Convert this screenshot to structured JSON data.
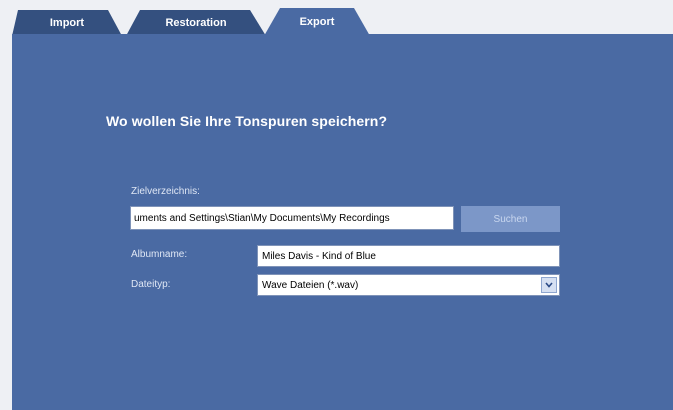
{
  "tabs": [
    {
      "label": "Import"
    },
    {
      "label": "Restoration"
    },
    {
      "label": "Export"
    }
  ],
  "export": {
    "heading": "Wo wollen Sie Ihre Tonspuren speichern?",
    "target_dir_label": "Zielverzeichnis:",
    "target_dir_value": "uments and Settings\\Stian\\My Documents\\My Recordings",
    "browse_label": "Suchen",
    "album_label": "Albumname:",
    "album_value": "Miles Davis - Kind of Blue",
    "filetype_label": "Dateityp:",
    "filetype_value": "Wave Dateien (*.wav)"
  },
  "colors": {
    "panel": "#4a6aa3",
    "tab_active": "#4a6aa3",
    "tab_inactive": "#34507f",
    "button": "#7c97c8"
  },
  "icons": {
    "dropdown": "chevron-down-icon"
  }
}
